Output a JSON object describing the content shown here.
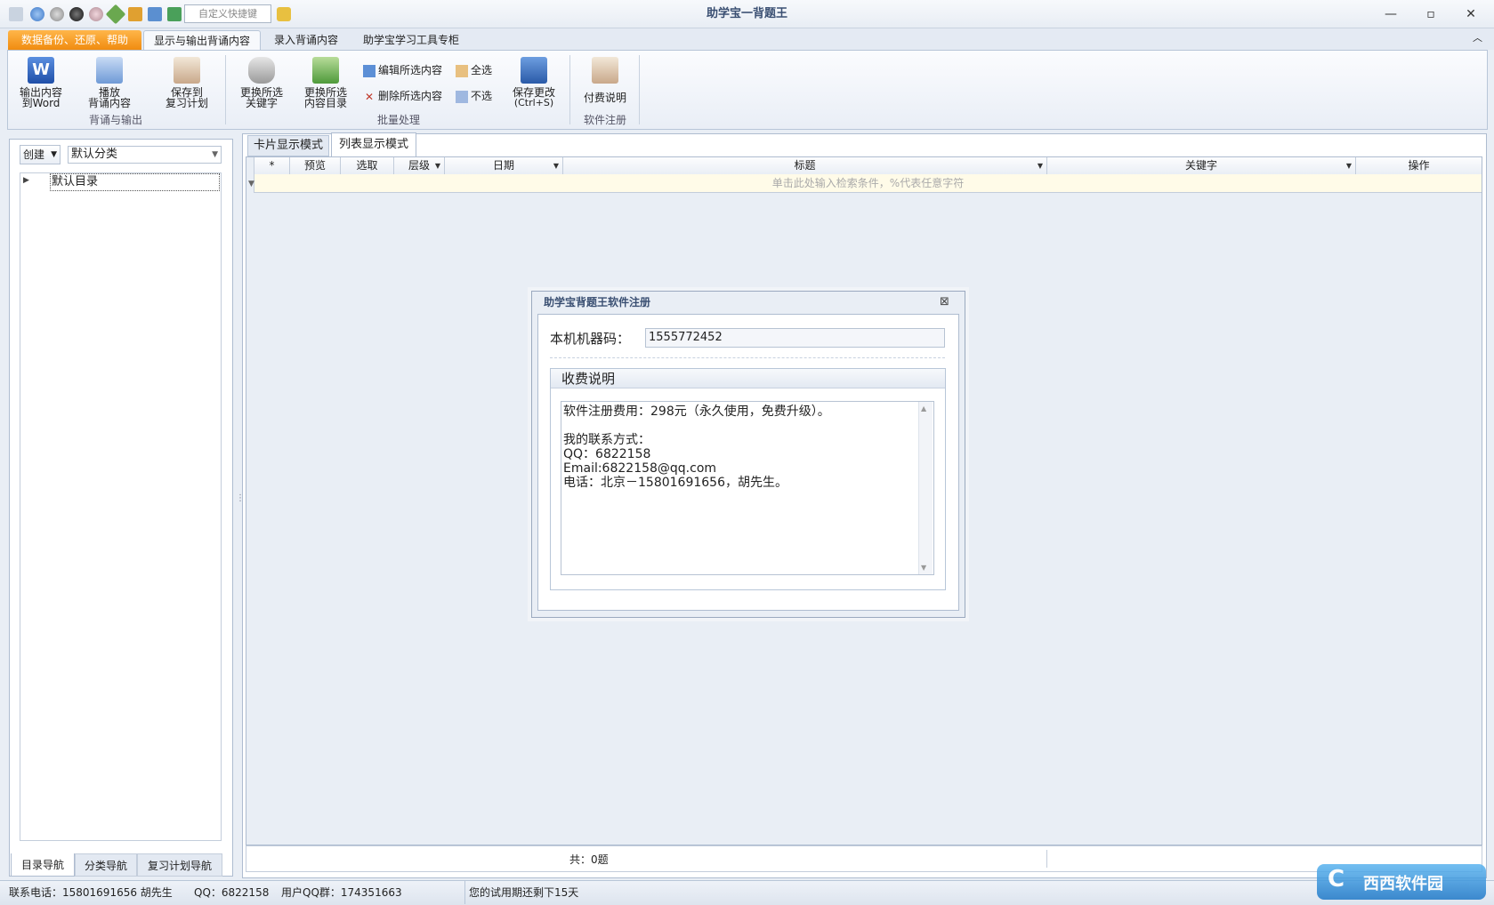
{
  "window": {
    "title": "助学宝一背题王",
    "quick_shortcut_placeholder": "自定义快捷键"
  },
  "ribbon_tabs": [
    "数据备份、还原、帮助",
    "显示与输出背诵内容",
    "录入背诵内容",
    "助学宝学习工具专柜"
  ],
  "ribbon": {
    "export_word": [
      "输出内容",
      "到Word"
    ],
    "play": [
      "播放",
      "背诵内容"
    ],
    "save_plan": [
      "保存到",
      "复习计划"
    ],
    "group1": "背诵与输出",
    "change_keyword": [
      "更换所选",
      "关键字"
    ],
    "change_dir": [
      "更换所选",
      "内容目录"
    ],
    "edit_selected": "编辑所选内容",
    "delete_selected": "删除所选内容",
    "select_all": "全选",
    "deselect": "不选",
    "save_changes": [
      "保存更改",
      "(Ctrl+S)"
    ],
    "group2": "批量处理",
    "payment": "付费说明",
    "group3": "软件注册"
  },
  "left_panel": {
    "create_button": "创建",
    "category_value": "默认分类",
    "tree_root": "默认目录",
    "tabs": [
      "目录导航",
      "分类导航",
      "复习计划导航"
    ]
  },
  "view_tabs": [
    "卡片显示模式",
    "列表显示模式"
  ],
  "grid": {
    "columns": [
      "*",
      "预览",
      "选取",
      "层级",
      "日期",
      "标题",
      "关键字",
      "操作"
    ],
    "search_hint": "单击此处输入检索条件，%代表任意字符",
    "footer_count": "共：0题"
  },
  "status_bar": {
    "phone": "联系电话：15801691656 胡先生",
    "qq": "QQ：6822158",
    "qq_group": "用户QQ群：174351663",
    "trial": "您的试用期还剩下15天"
  },
  "dialog": {
    "title": "助学宝背题王软件注册",
    "machine_label": "本机机器码：",
    "machine_code": "1555772452",
    "fee_header": "收费说明",
    "fee_text": "软件注册费用：298元（永久使用，免费升级）。\n\n我的联系方式：\nQQ：6822158\nEmail:6822158@qq.com\n电话：北京－15801691656，胡先生。"
  },
  "watermark": "西西软件园"
}
